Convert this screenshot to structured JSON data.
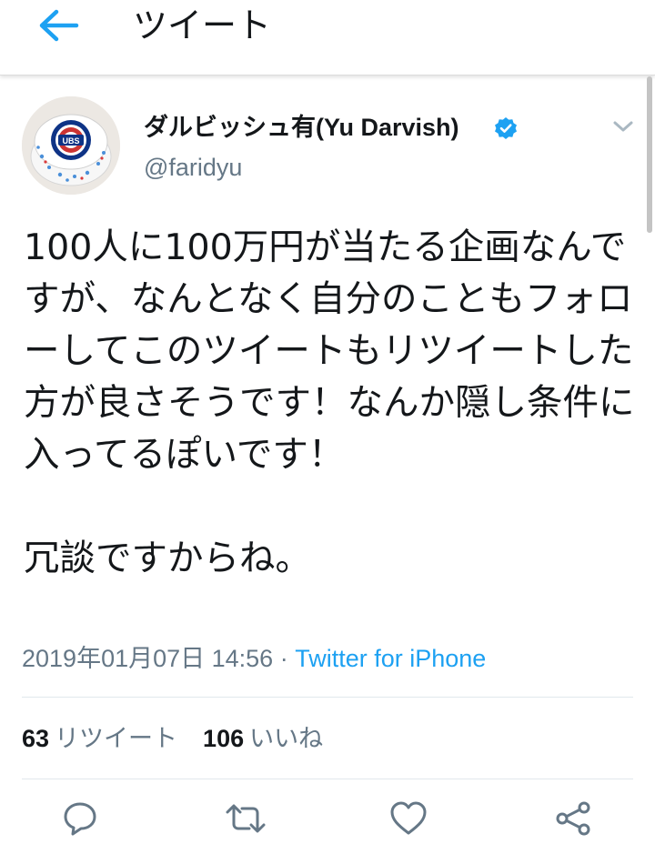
{
  "header": {
    "title": "ツイート",
    "back_icon": "arrow-left-icon",
    "accent_color": "#1da1f2"
  },
  "author": {
    "display_name": "ダルビッシュ有(Yu Darvish)",
    "handle": "@faridyu",
    "verified": true,
    "avatar_icon": "cubs-logo-cake-avatar"
  },
  "tweet": {
    "text": "100人に100万円が当たる企画なんですが、なんとなく自分のこともフォローしてこのツイートもリツイートした方が良さそうです！なんか隠し条件に入ってるぽいです！\n\n冗談ですからね。",
    "timestamp": "2019年01月07日 14:56",
    "separator": " · ",
    "source": "Twitter for iPhone"
  },
  "stats": {
    "retweets": {
      "count": "63",
      "label": "リツイート"
    },
    "likes": {
      "count": "106",
      "label": "いいね"
    }
  },
  "actions": [
    {
      "name": "reply",
      "icon": "reply-icon"
    },
    {
      "name": "retweet",
      "icon": "retweet-icon"
    },
    {
      "name": "like",
      "icon": "heart-icon"
    },
    {
      "name": "share",
      "icon": "share-icon"
    }
  ],
  "colors": {
    "text": "#14171a",
    "secondary": "#657786",
    "link": "#1da1f2",
    "divider": "#e1e8ed"
  }
}
